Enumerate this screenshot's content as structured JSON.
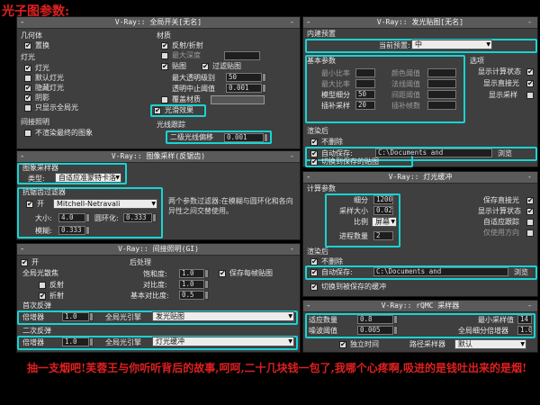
{
  "page_title": "光子图参数:",
  "caption": "抽一支烟吧!芙蓉王与你听听背后的故事,呵呵,二十几块钱一包了,我哪个心疼啊,吸进的是钱吐出来的是烟!",
  "colors": {
    "highlight": "#19d3d3",
    "caption": "#e02020",
    "panel": "#3f3f3f"
  },
  "global_switches": {
    "title": "V-Ray:: 全局开关[无名]",
    "geometry": "几何体",
    "displacement": "置换",
    "lights": "灯光",
    "lights_opt": "灯光",
    "default_lights": "默认灯光",
    "hidden_lights": "隐藏灯光",
    "shadows": "阴影",
    "show_gi_only": "只显示全局光",
    "indirect": "间接照明",
    "dont_render_final": "不渲染最终的图象",
    "materials": "材质",
    "reflect_refract": "反射/折射",
    "max_depth": "最大深度",
    "maps": "贴图",
    "filter_maps": "过滤贴图",
    "max_transp": "最大透明级别",
    "max_transp_val": "50",
    "transp_cutoff": "透明中止阈值",
    "transp_cutoff_val": "0.001",
    "override_mtl": "覆盖材质",
    "glossy": "光滑效果",
    "raytrace": "光线跟踪",
    "secondary_bias": "二级光线偏移",
    "secondary_bias_val": "0.001"
  },
  "image_sampler": {
    "title": "V-Ray:: 图像采样(反锯齿)",
    "sampler_group": "图象采样器",
    "type_label": "类型:",
    "type_value": "自适应准蒙特卡洛",
    "aa_group": "抗锯齿过滤器",
    "on": "开",
    "filter_value": "Mitchell-Netravali",
    "filter_desc": "两个参数过滤器:在模糊与圆环化和各向异性之间交替使用。",
    "size_label": "大小:",
    "size_val": "4.0",
    "ring_label": "圆环化:",
    "ring_val": "0.333",
    "blur_label": "模糊:",
    "blur_val": "0.333"
  },
  "gi": {
    "title": "V-Ray:: 间接照明(GI)",
    "on": "开",
    "caustics": "全局光散焦",
    "reflective": "反射",
    "refractive": "折射",
    "post": "后处理",
    "saturation": "饱和度:",
    "saturation_val": "1.0",
    "contrast": "对比度:",
    "contrast_val": "1.0",
    "contrast_base": "基本对比度:",
    "contrast_base_val": "0.5",
    "save_maps": "保存每帧贴图",
    "primary_bounces": "首次反弹",
    "multiplier": "倍增器",
    "primary_mult": "1.0",
    "gi_engine": "全局光引擎",
    "primary_engine": "发光贴图",
    "secondary_bounces": "二次反弹",
    "secondary_mult": "1.0",
    "secondary_engine": "灯光缓冲"
  },
  "irradiance": {
    "title": "V-Ray:: 发光贴图[无名]",
    "builtin": "内建预置",
    "current_preset": "当前预置:",
    "preset_value": "中",
    "basic": "基本参数",
    "min_rate": "最小比率",
    "max_rate": "最大比率",
    "model_subdivs": "模型细分",
    "model_subdivs_val": "50",
    "interp_samples": "插补采样",
    "interp_samples_val": "20",
    "clr_thresh": "颜色阈值",
    "nrm_thresh": "法线阈值",
    "dist_thresh": "间距阈值",
    "interp_frames": "插补帧数",
    "options": "选项",
    "show_calc": "显示计算状态",
    "show_direct": "显示直接光",
    "show_samples": "显示采样",
    "on_render_end": "渲染后",
    "dont_delete": "不删除",
    "auto_save": "自动保存:",
    "path": "C:\\Documents and",
    "browse": "浏览",
    "switch_saved": "切换到保存的贴图"
  },
  "light_cache": {
    "title": "V-Ray:: 灯光缓冲",
    "calc_params": "计算参数",
    "subdivs": "细分",
    "subdivs_val": "1200",
    "sample_size": "采样大小",
    "sample_size_val": "0.02",
    "scale": "比例",
    "scale_val": "屏幕",
    "passes": "进程数量",
    "passes_val": "2",
    "store_direct": "保存直接光",
    "show_calc": "显示计算状态",
    "adaptive": "自适应跟踪",
    "use_camera": "仅使用方向",
    "on_render_end": "渲染后",
    "dont_delete": "不删除",
    "auto_save": "自动保存:",
    "path": "C:\\Documents and",
    "browse": "浏览",
    "switch_saved": "切换到被保存的缓冲"
  },
  "rqmc": {
    "title": "V-Ray:: rQMC 采样器",
    "adaptive_amount": "适应数量",
    "adaptive_amount_val": "0.8",
    "noise_thresh": "噪波阈值",
    "noise_thresh_val": "0.005",
    "time_indep": "独立时间",
    "min_samples": "最小采样值",
    "min_samples_val": "14",
    "global_subdivs": "全局细分倍增器",
    "global_subdivs_val": "1.0",
    "path_sampler": "路径采样器",
    "path_sampler_val": "默认"
  }
}
